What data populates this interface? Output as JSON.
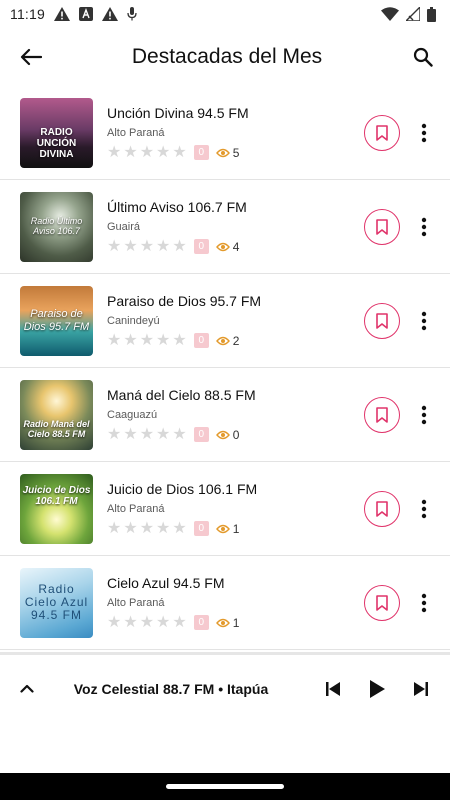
{
  "status_bar": {
    "time": "11:19"
  },
  "header": {
    "title": "Destacadas del Mes"
  },
  "stations": [
    {
      "name": "Unción Divina 94.5 FM",
      "location": "Alto Paraná",
      "rating": "0",
      "views": "5",
      "cover_text": "RADIO UNCIÓN DIVINA"
    },
    {
      "name": "Último Aviso 106.7 FM",
      "location": "Guairá",
      "rating": "0",
      "views": "4",
      "cover_text": "Radio Último Aviso 106.7"
    },
    {
      "name": "Paraiso de Dios 95.7 FM",
      "location": "Canindeyú",
      "rating": "0",
      "views": "2",
      "cover_text": "Paraiso de Dios 95.7 FM"
    },
    {
      "name": "Maná del Cielo 88.5 FM",
      "location": "Caaguazú",
      "rating": "0",
      "views": "0",
      "cover_text": "Radio Maná del Cielo 88.5 FM"
    },
    {
      "name": "Juicio de Dios 106.1 FM",
      "location": "Alto Paraná",
      "rating": "0",
      "views": "1",
      "cover_text": "Juicio de Dios 106.1 FM"
    },
    {
      "name": "Cielo Azul 94.5 FM",
      "location": "Alto Paraná",
      "rating": "0",
      "views": "1",
      "cover_text": "Radio Cielo Azul 94.5 FM"
    }
  ],
  "player": {
    "now_playing": "Voz Celestial 88.7 FM • Itapúa"
  },
  "colors": {
    "accent": "#e0336a",
    "view_icon": "#e39a2c",
    "star_empty": "#d8d8d8"
  },
  "icons": {
    "back": "arrow-left-icon",
    "search": "search-icon",
    "bookmark": "bookmark-icon",
    "more": "more-vertical-icon",
    "eye": "eye-icon",
    "expand": "chevron-up-icon",
    "previous": "skip-previous-icon",
    "play": "play-icon",
    "next": "skip-next-icon"
  }
}
